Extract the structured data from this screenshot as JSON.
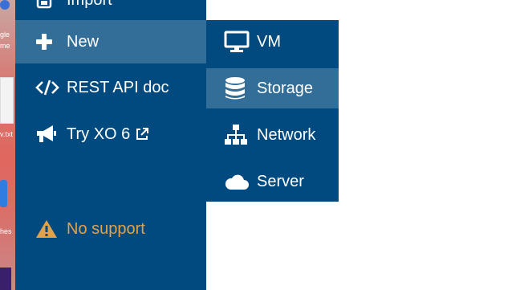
{
  "sidebar": {
    "items": [
      {
        "label": "Import",
        "icon": "import-icon"
      },
      {
        "label": "New",
        "icon": "plus-icon",
        "active": true
      },
      {
        "label": "REST API doc",
        "icon": "code-icon"
      },
      {
        "label": "Try XO 6",
        "icon": "megaphone-icon",
        "suffix_icon": "external-link-icon"
      }
    ],
    "support": {
      "label": "No support",
      "icon": "warning-icon",
      "color": "#e2a24a"
    }
  },
  "submenu": {
    "items": [
      {
        "label": "VM",
        "icon": "monitor-icon"
      },
      {
        "label": "Storage",
        "icon": "database-icon",
        "active": true
      },
      {
        "label": "Network",
        "icon": "sitemap-icon"
      },
      {
        "label": "Server",
        "icon": "cloud-icon"
      }
    ]
  },
  "desktop_fragments": {
    "item1": "gle",
    "item2": "me",
    "item3": "v.txt",
    "item4": "hes"
  },
  "colors": {
    "sidebar_bg": "#004a7f",
    "active_bg": "#336e99",
    "text": "#ffffff",
    "warning": "#e2a24a"
  }
}
